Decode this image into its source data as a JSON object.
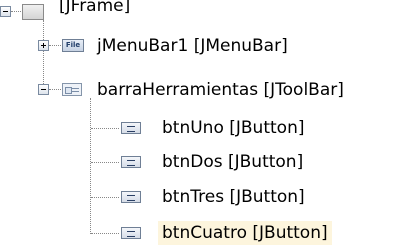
{
  "tree": {
    "root": {
      "label": "[JFrame]",
      "icon": "frame-icon"
    },
    "menubar": {
      "label": "jMenuBar1 [JMenuBar]",
      "icon": "file-icon",
      "icon_text": "File",
      "expander": "plus"
    },
    "toolbar": {
      "label": "barraHerramientas [JToolBar]",
      "icon": "toolbar-icon",
      "expander": "minus"
    },
    "buttons": [
      {
        "label": "btnUno [JButton]",
        "icon": "button-icon"
      },
      {
        "label": "btnDos [JButton]",
        "icon": "button-icon"
      },
      {
        "label": "btnTres [JButton]",
        "icon": "button-icon"
      },
      {
        "label": "btnCuatro [JButton]",
        "icon": "button-icon",
        "selected": true
      }
    ]
  },
  "colors": {
    "selection_background": "#fdf5dd",
    "connector_line": "#888888"
  }
}
